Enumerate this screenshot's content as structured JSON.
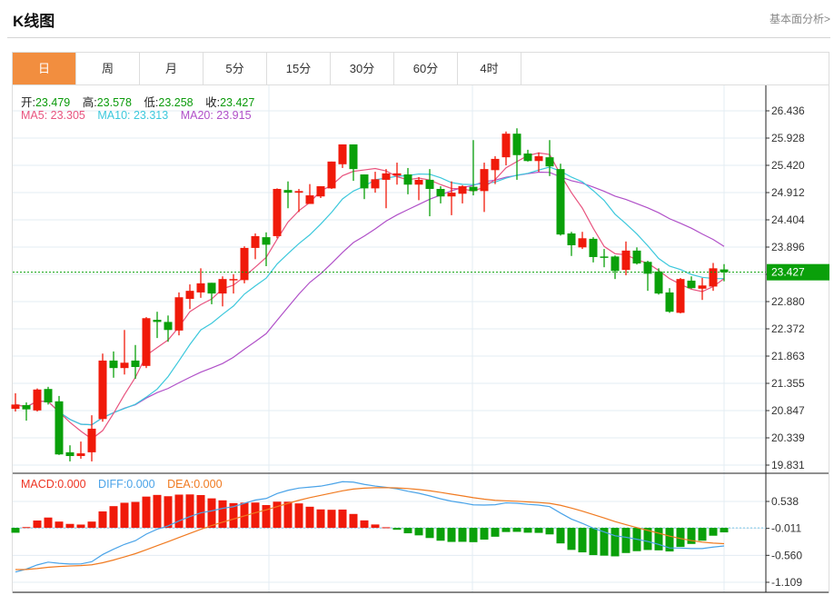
{
  "header": {
    "title": "K线图",
    "link": "基本面分析>"
  },
  "tabs": [
    {
      "label": "日",
      "active": true
    },
    {
      "label": "周"
    },
    {
      "label": "月"
    },
    {
      "label": "5分"
    },
    {
      "label": "15分"
    },
    {
      "label": "30分"
    },
    {
      "label": "60分"
    },
    {
      "label": "4时"
    }
  ],
  "info": {
    "open_label": "开:",
    "open": "23.479",
    "high_label": "高:",
    "high": "23.578",
    "low_label": "低:",
    "low": "23.258",
    "close_label": "收:",
    "close": "23.427",
    "ma5": "MA5: 23.305",
    "ma10": "MA10: 23.313",
    "ma20": "MA20: 23.915"
  },
  "macd_info": {
    "macd": "MACD:0.000",
    "diff": "DIFF:0.000",
    "dea": "DEA:0.000"
  },
  "current_price": "23.427",
  "colors": {
    "up": "#f01a0a",
    "down": "#0aa00a",
    "ma5": "#e8547f",
    "ma10": "#3cc8dc",
    "ma20": "#b050c8",
    "diff": "#4aa3e8",
    "dea": "#f07a20",
    "current": "#0aa00a"
  },
  "chart_data": {
    "type": "candlestick",
    "price_ticks": [
      "26.436",
      "25.928",
      "25.420",
      "24.912",
      "24.404",
      "23.896",
      "23.388",
      "22.880",
      "22.372",
      "21.863",
      "21.355",
      "20.847",
      "20.339",
      "19.831"
    ],
    "ylim": [
      19.831,
      26.436
    ],
    "macd_ticks": [
      "0.538",
      "-0.011",
      "-0.560",
      "-1.109"
    ],
    "macd_ylim": [
      -1.109,
      0.538
    ],
    "ohlc": [
      [
        20.88,
        21.17,
        20.83,
        20.96
      ],
      [
        20.95,
        21.0,
        20.66,
        20.87
      ],
      [
        20.85,
        21.26,
        20.83,
        21.24
      ],
      [
        21.25,
        21.29,
        20.96,
        21.0
      ],
      [
        21.02,
        21.12,
        20.02,
        20.03
      ],
      [
        20.07,
        20.2,
        19.9,
        20.0
      ],
      [
        20.0,
        20.27,
        19.95,
        20.05
      ],
      [
        20.07,
        20.76,
        19.9,
        20.51
      ],
      [
        20.69,
        21.91,
        20.64,
        21.78
      ],
      [
        21.78,
        21.95,
        21.46,
        21.64
      ],
      [
        21.64,
        22.35,
        21.52,
        21.74
      ],
      [
        21.78,
        22.07,
        21.44,
        21.66
      ],
      [
        21.68,
        22.59,
        21.64,
        22.57
      ],
      [
        22.54,
        22.69,
        22.2,
        22.5
      ],
      [
        22.5,
        22.62,
        22.13,
        22.35
      ],
      [
        22.34,
        23.05,
        22.25,
        22.96
      ],
      [
        22.93,
        23.2,
        22.74,
        23.08
      ],
      [
        23.05,
        23.5,
        22.95,
        23.22
      ],
      [
        23.23,
        23.23,
        22.83,
        23.03
      ],
      [
        23.03,
        23.35,
        22.79,
        23.3
      ],
      [
        23.28,
        23.39,
        23.03,
        23.3
      ],
      [
        23.28,
        23.91,
        23.22,
        23.88
      ],
      [
        23.88,
        24.15,
        23.67,
        24.1
      ],
      [
        24.08,
        24.17,
        23.54,
        23.94
      ],
      [
        24.1,
        24.99,
        24.06,
        24.98
      ],
      [
        24.96,
        25.12,
        24.62,
        24.91
      ],
      [
        24.91,
        24.98,
        24.55,
        24.94
      ],
      [
        24.7,
        25.07,
        24.7,
        24.86
      ],
      [
        24.84,
        25.03,
        24.81,
        25.03
      ],
      [
        24.99,
        25.49,
        24.98,
        25.49
      ],
      [
        25.44,
        25.81,
        25.37,
        25.81
      ],
      [
        25.81,
        25.81,
        25.13,
        25.35
      ],
      [
        25.25,
        25.25,
        24.79,
        24.99
      ],
      [
        24.99,
        25.3,
        24.91,
        25.16
      ],
      [
        25.15,
        25.35,
        24.62,
        25.27
      ],
      [
        25.23,
        25.47,
        25.06,
        25.27
      ],
      [
        25.25,
        25.37,
        24.88,
        25.06
      ],
      [
        25.06,
        25.2,
        24.77,
        25.15
      ],
      [
        25.15,
        25.35,
        24.47,
        24.98
      ],
      [
        24.98,
        25.03,
        24.71,
        24.84
      ],
      [
        24.84,
        25.12,
        24.49,
        24.91
      ],
      [
        24.89,
        25.05,
        24.71,
        25.03
      ],
      [
        25.02,
        25.89,
        24.86,
        24.94
      ],
      [
        24.94,
        25.47,
        24.55,
        25.35
      ],
      [
        25.33,
        25.59,
        25.07,
        25.54
      ],
      [
        25.57,
        26.05,
        25.42,
        26.01
      ],
      [
        26.01,
        26.11,
        25.15,
        25.61
      ],
      [
        25.64,
        25.71,
        25.49,
        25.5
      ],
      [
        25.5,
        25.66,
        25.3,
        25.59
      ],
      [
        25.57,
        25.89,
        25.22,
        25.4
      ],
      [
        25.35,
        25.45,
        24.11,
        24.13
      ],
      [
        24.15,
        24.18,
        23.73,
        23.93
      ],
      [
        23.89,
        24.18,
        23.86,
        24.06
      ],
      [
        24.05,
        24.08,
        23.61,
        23.71
      ],
      [
        23.72,
        23.86,
        23.52,
        23.71
      ],
      [
        23.72,
        23.74,
        23.3,
        23.45
      ],
      [
        23.47,
        24.0,
        23.37,
        23.83
      ],
      [
        23.83,
        23.89,
        23.57,
        23.59
      ],
      [
        23.62,
        23.64,
        23.08,
        23.4
      ],
      [
        23.44,
        23.5,
        23.01,
        23.03
      ],
      [
        23.05,
        23.13,
        22.67,
        22.69
      ],
      [
        22.67,
        23.32,
        22.66,
        23.3
      ],
      [
        23.27,
        23.35,
        23.12,
        23.13
      ],
      [
        23.12,
        23.32,
        22.91,
        23.18
      ],
      [
        23.16,
        23.6,
        23.08,
        23.5
      ],
      [
        23.479,
        23.578,
        23.258,
        23.427
      ]
    ]
  }
}
